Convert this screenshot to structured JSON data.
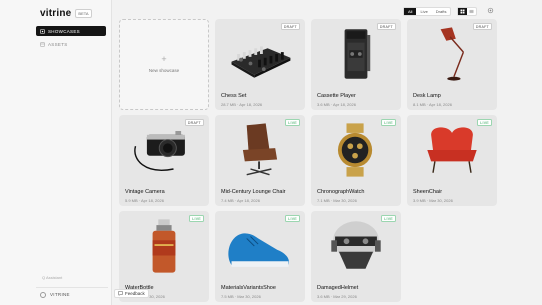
{
  "app": {
    "name": "vitrine",
    "badge": "BETA"
  },
  "sidebar": {
    "items": [
      {
        "label": "SHOWCASES",
        "icon": "showcase-icon",
        "active": true
      },
      {
        "label": "ASSETS",
        "icon": "assets-icon",
        "active": false
      }
    ],
    "footer_small": "Q Assistant",
    "user_label": "VITRINE"
  },
  "toolbar": {
    "filters": [
      {
        "label": "All",
        "active": true
      },
      {
        "label": "Live",
        "active": false
      },
      {
        "label": "Drafts",
        "active": false
      }
    ],
    "view_modes": [
      "grid-view-icon",
      "list-view-icon"
    ],
    "settings_icon": "settings-icon"
  },
  "new_showcase": {
    "plus": "+",
    "label": "New showcase"
  },
  "cards": [
    {
      "title": "Chess Set",
      "meta": "28.7 MB · Apr 18, 2026",
      "status": "DRAFT",
      "art": "chess"
    },
    {
      "title": "Cassette Player",
      "meta": "3.6 MB · Apr 18, 2026",
      "status": "DRAFT",
      "art": "cassette"
    },
    {
      "title": "Desk Lamp",
      "meta": "8.1 MB · Apr 18, 2026",
      "status": "DRAFT",
      "art": "lamp"
    },
    {
      "title": "Vintage Camera",
      "meta": "5.9 MB · Apr 18, 2026",
      "status": "DRAFT",
      "art": "camera"
    },
    {
      "title": "Mid-Century Lounge Chair",
      "meta": "7.4 MB · Apr 18, 2026",
      "status": "LIVE",
      "art": "lounge"
    },
    {
      "title": "ChronographWatch",
      "meta": "7.1 MB · Mar 30, 2026",
      "status": "LIVE",
      "art": "watch"
    },
    {
      "title": "SheenChair",
      "meta": "3.9 MB · Mar 30, 2026",
      "status": "LIVE",
      "art": "sheen"
    },
    {
      "title": "WaterBottle",
      "meta": "9.4 MB · Mar 30, 2026",
      "status": "LIVE",
      "art": "bottle"
    },
    {
      "title": "MaterialsVariantsShoe",
      "meta": "7.5 MB · Mar 30, 2026",
      "status": "LIVE",
      "art": "shoe"
    },
    {
      "title": "DamagedHelmet",
      "meta": "3.6 MB · Mar 29, 2026",
      "status": "LIVE",
      "art": "helmet"
    }
  ],
  "feedback": {
    "label": "Feedback",
    "icon": "chat-icon"
  }
}
